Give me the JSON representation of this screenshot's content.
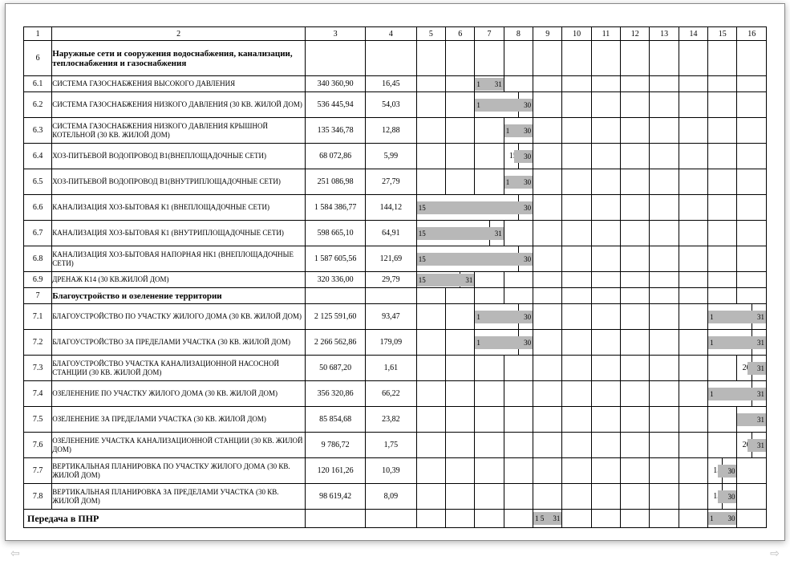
{
  "header_cols": [
    "1",
    "2",
    "3",
    "4",
    "5",
    "6",
    "7",
    "8",
    "9",
    "10",
    "11",
    "12",
    "13",
    "14",
    "15",
    "16"
  ],
  "sections": {
    "s6": {
      "num": "6",
      "title": "Наружные сети и сооружения водоснабжения, канализации, теплоснабжения и газоснабжения"
    },
    "s7": {
      "num": "7",
      "title": "Благоустройство и озеленение территории"
    }
  },
  "rows": {
    "r61": {
      "num": "6.1",
      "desc": "СИСТЕМА ГАЗОСНАБЖЕНИЯ ВЫСОКОГО ДАВЛЕНИЯ",
      "v1": "340 360,90",
      "v2": "16,45"
    },
    "r62": {
      "num": "6.2",
      "desc": "СИСТЕМА ГАЗОСНАБЖЕНИЯ НИЗКОГО ДАВЛЕНИЯ (30 КВ. ЖИЛОЙ ДОМ)",
      "v1": "536 445,94",
      "v2": "54,03"
    },
    "r63": {
      "num": "6.3",
      "desc": "СИСТЕМА ГАЗОСНАБЖЕНИЯ НИЗКОГО ДАВЛЕНИЯ КРЫШНОЙ КОТЕЛЬНОЙ (30 КВ. ЖИЛОЙ ДОМ)",
      "v1": "135 346,78",
      "v2": "12,88"
    },
    "r64": {
      "num": "6.4",
      "desc": "ХОЗ-ПИТЬЕВОЙ ВОДОПРОВОД В1(ВНЕПЛОЩАДОЧНЫЕ СЕТИ)",
      "v1": "68 072,86",
      "v2": "5,99"
    },
    "r65": {
      "num": "6.5",
      "desc": "ХОЗ-ПИТЬЕВОЙ ВОДОПРОВОД В1(ВНУТРИПЛОЩАДОЧНЫЕ СЕТИ)",
      "v1": "251 086,98",
      "v2": "27,79"
    },
    "r66": {
      "num": "6.6",
      "desc": "КАНАЛИЗАЦИЯ ХОЗ-БЫТОВАЯ К1 (ВНЕПЛОЩАДОЧНЫЕ СЕТИ)",
      "v1": "1 584 386,77",
      "v2": "144,12"
    },
    "r67": {
      "num": "6.7",
      "desc": "КАНАЛИЗАЦИЯ ХОЗ-БЫТОВАЯ К1 (ВНУТРИПЛОЩАДОЧНЫЕ СЕТИ)",
      "v1": "598 665,10",
      "v2": "64,91"
    },
    "r68": {
      "num": "6.8",
      "desc": "КАНАЛИЗАЦИЯ ХОЗ-БЫТОВАЯ НАПОРНАЯ НК1 (ВНЕПЛОЩАДОЧНЫЕ СЕТИ)",
      "v1": "1 587 605,56",
      "v2": "121,69"
    },
    "r69": {
      "num": "6.9",
      "desc": "ДРЕНАЖ К14 (30 КВ.ЖИЛОЙ ДОМ)",
      "v1": "320 336,00",
      "v2": "29,79"
    },
    "r71": {
      "num": "7.1",
      "desc": "БЛАГОУСТРОЙСТВО ПО УЧАСТКУ ЖИЛОГО ДОМА (30 КВ. ЖИЛОЙ ДОМ)",
      "v1": "2 125 591,60",
      "v2": "93,47"
    },
    "r72": {
      "num": "7.2",
      "desc": "БЛАГОУСТРОЙСТВО ЗА ПРЕДЕЛАМИ УЧАСТКА (30 КВ. ЖИЛОЙ ДОМ)",
      "v1": "2 266 562,86",
      "v2": "179,09"
    },
    "r73": {
      "num": "7.3",
      "desc": "БЛАГОУСТРОЙСТВО УЧАСТКА КАНАЛИЗАЦИОННОЙ НАСОСНОЙ СТАНЦИИ (30 КВ. ЖИЛОЙ ДОМ)",
      "v1": "50 687,20",
      "v2": "1,61"
    },
    "r74": {
      "num": "7.4",
      "desc": "ОЗЕЛЕНЕНИЕ ПО УЧАСТКУ ЖИЛОГО ДОМА (30 КВ. ЖИЛОЙ ДОМ)",
      "v1": "356 320,86",
      "v2": "66,22"
    },
    "r75": {
      "num": "7.5",
      "desc": "ОЗЕЛЕНЕНИЕ ЗА ПРЕДЕЛАМИ УЧАСТКА (30 КВ. ЖИЛОЙ ДОМ)",
      "v1": "85 854,68",
      "v2": "23,82"
    },
    "r76": {
      "num": "7.6",
      "desc": "ОЗЕЛЕНЕНИЕ УЧАСТКА КАНАЛИЗАЦИОННОЙ СТАНЦИИ (30 КВ. ЖИЛОЙ ДОМ)",
      "v1": "9 786,72",
      "v2": "1,75"
    },
    "r77": {
      "num": "7.7",
      "desc": "ВЕРТИКАЛЬНАЯ ПЛАНИРОВКА ПО УЧАСТКУ ЖИЛОГО ДОМА (30 КВ. ЖИЛОЙ ДОМ)",
      "v1": "120 161,26",
      "v2": "10,39"
    },
    "r78": {
      "num": "7.8",
      "desc": "ВЕРТИКАЛЬНАЯ ПЛАНИРОВКА ЗА ПРЕДЕЛАМИ УЧАСТКА (30 КВ. ЖИЛОЙ ДОМ)",
      "v1": "98 619,42",
      "v2": "8,09"
    }
  },
  "footer": {
    "label": "Передача в ПНР"
  },
  "marks": {
    "n1": "1",
    "n15": "15",
    "n20": "20",
    "n30": "30",
    "n31": "31",
    "n1_5": "1 5"
  }
}
